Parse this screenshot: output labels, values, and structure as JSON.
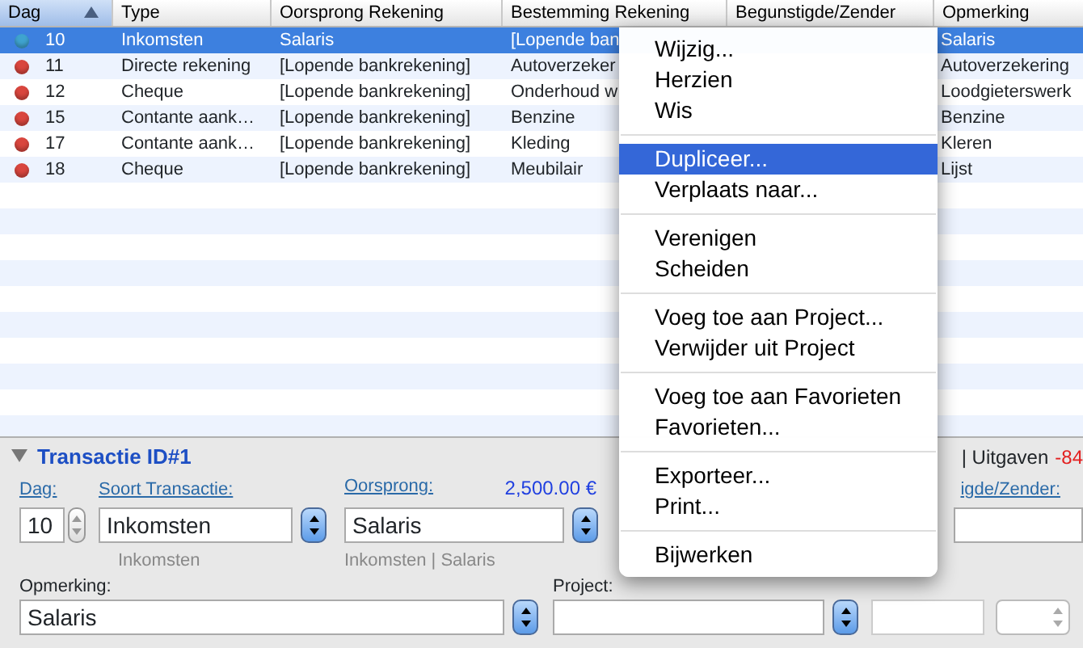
{
  "table": {
    "columns": [
      {
        "label": "Dag",
        "sorted": true
      },
      {
        "label": "Type",
        "sorted": false
      },
      {
        "label": "Oorsprong Rekening",
        "sorted": false
      },
      {
        "label": "Bestemming Rekening",
        "sorted": false
      },
      {
        "label": "Begunstigde/Zender",
        "sorted": false
      },
      {
        "label": "Opmerking",
        "sorted": false
      }
    ],
    "rows": [
      {
        "day": "10",
        "type": "Inkomsten",
        "origin": "Salaris",
        "destination": "[Lopende ban",
        "remark": "Salaris",
        "color": "#3fa3cf",
        "selected": true
      },
      {
        "day": "11",
        "type": "Directe rekening",
        "origin": "[Lopende bankrekening]",
        "destination": "Autoverzeker",
        "remark": "Autoverzekering",
        "color": "#d9463e",
        "selected": false
      },
      {
        "day": "12",
        "type": "Cheque",
        "origin": "[Lopende bankrekening]",
        "destination": "Onderhoud w",
        "remark": "Loodgieterswerk",
        "color": "#d9463e",
        "selected": false
      },
      {
        "day": "15",
        "type": "Contante aank…",
        "origin": "[Lopende bankrekening]",
        "destination": "Benzine",
        "remark": "Benzine",
        "color": "#d9463e",
        "selected": false
      },
      {
        "day": "17",
        "type": "Contante aank…",
        "origin": "[Lopende bankrekening]",
        "destination": "Kleding",
        "remark": "Kleren",
        "color": "#d9463e",
        "selected": false
      },
      {
        "day": "18",
        "type": "Cheque",
        "origin": "[Lopende bankrekening]",
        "destination": "Meubilair",
        "remark": "Lijst",
        "color": "#d9463e",
        "selected": false
      }
    ]
  },
  "transaction": {
    "title": "Transactie ID#1",
    "expanded": true,
    "summary": {
      "text": "| Uitgaven",
      "amount": "-84"
    },
    "day": {
      "label": "Dag:",
      "value": "10"
    },
    "type": {
      "label": "Soort Transactie:",
      "value": "Inkomsten",
      "hint": "Inkomsten"
    },
    "origin": {
      "label": "Oorsprong:",
      "amount": "2,500.00 €",
      "value": "Salaris",
      "hint": "Inkomsten | Salaris"
    },
    "payee": {
      "label": "igde/Zender:"
    },
    "remark": {
      "label": "Opmerking:",
      "value": "Salaris"
    },
    "project": {
      "label": "Project:"
    }
  },
  "context_menu": {
    "sections": [
      {
        "items": [
          {
            "label": "Wijzig...",
            "selected": false
          },
          {
            "label": "Herzien",
            "selected": false
          },
          {
            "label": "Wis",
            "selected": false
          }
        ]
      },
      {
        "items": [
          {
            "label": "Dupliceer...",
            "selected": true
          },
          {
            "label": "Verplaats naar...",
            "selected": false
          }
        ]
      },
      {
        "items": [
          {
            "label": "Verenigen",
            "selected": false
          },
          {
            "label": "Scheiden",
            "selected": false
          }
        ]
      },
      {
        "items": [
          {
            "label": "Voeg toe aan Project...",
            "selected": false
          },
          {
            "label": "Verwijder uit Project",
            "selected": false
          }
        ]
      },
      {
        "items": [
          {
            "label": "Voeg toe aan Favorieten",
            "selected": false
          },
          {
            "label": "Favorieten...",
            "selected": false
          }
        ]
      },
      {
        "items": [
          {
            "label": "Exporteer...",
            "selected": false
          },
          {
            "label": "Print...",
            "selected": false
          }
        ]
      },
      {
        "items": [
          {
            "label": "Bijwerken",
            "selected": false
          }
        ]
      }
    ]
  }
}
